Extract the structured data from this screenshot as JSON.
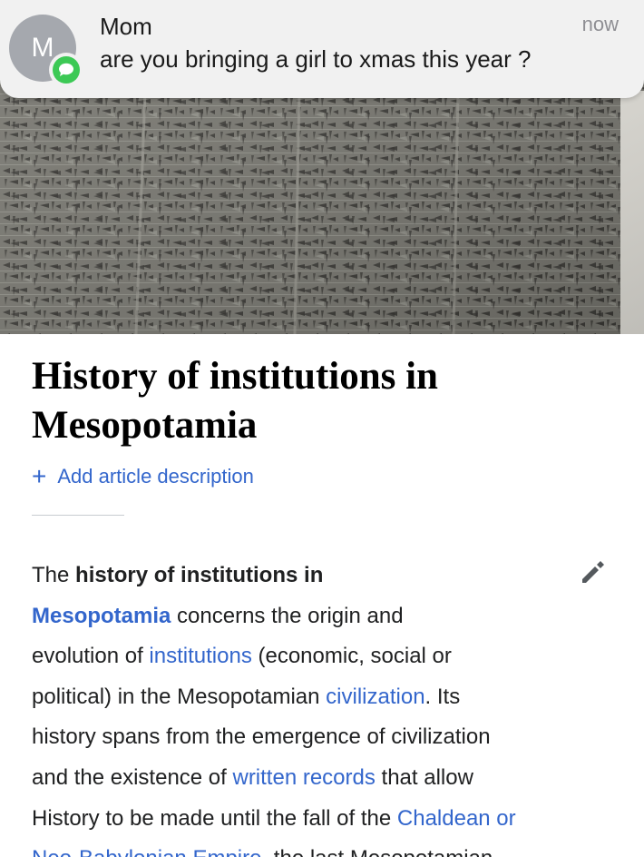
{
  "notification": {
    "avatar_initial": "M",
    "sender": "Mom",
    "time": "now",
    "message": "are you bringing a girl to xmas this year ?",
    "app_icon": "messages-icon",
    "accent": "#3cc955"
  },
  "article": {
    "title_line1": "History of institutions in",
    "title_line2": "Mesopotamia",
    "add_description_icon": "plus-icon",
    "add_description_label": "Add article description",
    "edit_icon": "pencil-icon",
    "link_color": "#3366cc",
    "paragraph": {
      "l1_a": "The ",
      "l1_b": "history of institutions in",
      "l2_link": "Mesopotamia",
      "l2_b": " concerns the origin and",
      "l3_a": "evolution of ",
      "l3_link": "institutions",
      "l3_b": " (economic, social or",
      "l4_a": "political) in the Mesopotamian ",
      "l4_link": "civilization",
      "l4_b": ". Its",
      "l5": "history spans from the emergence of civilization",
      "l6_a": "and the existence of ",
      "l6_link": "written records",
      "l6_b": " that allow",
      "l7_a": "History to be made until the fall of the ",
      "l7_link": "Chaldean or",
      "l8_link": "Neo-Babylonian Empire",
      "l8_b": ", the last Mesopotamian"
    }
  }
}
